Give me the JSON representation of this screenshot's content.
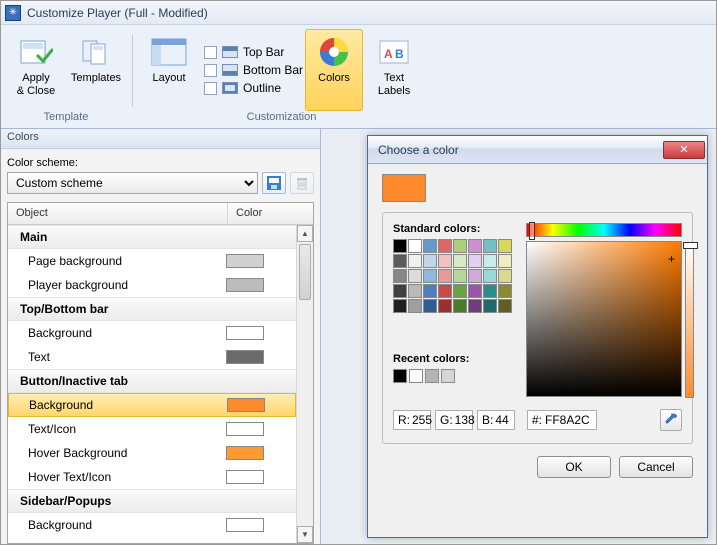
{
  "window": {
    "title": "Customize Player (Full - Modified)"
  },
  "ribbon": {
    "apply_close": "Apply\n& Close",
    "templates": "Templates",
    "layout": "Layout",
    "colors": "Colors",
    "text_labels": "Text\nLabels",
    "group_template": "Template",
    "group_customization": "Customization",
    "opt_topbar": "Top Bar",
    "opt_bottombar": "Bottom Bar",
    "opt_outline": "Outline"
  },
  "panel": {
    "title": "Colors",
    "scheme_label": "Color scheme:",
    "scheme_value": "Custom scheme",
    "col_object": "Object",
    "col_color": "Color",
    "rows": [
      {
        "type": "cat",
        "label": "Main"
      },
      {
        "type": "item",
        "label": "Page background",
        "color": "#d0d0d0"
      },
      {
        "type": "item",
        "label": "Player background",
        "color": "#bcbcbc"
      },
      {
        "type": "cat",
        "label": "Top/Bottom bar"
      },
      {
        "type": "item",
        "label": "Background",
        "color": "#ffffff"
      },
      {
        "type": "item",
        "label": "Text",
        "color": "#6b6b6b"
      },
      {
        "type": "cat",
        "label": "Button/Inactive tab"
      },
      {
        "type": "item",
        "label": "Background",
        "color": "#ff8a2c",
        "selected": true
      },
      {
        "type": "item",
        "label": "Text/Icon",
        "color": "#ffffff"
      },
      {
        "type": "item",
        "label": "Hover Background",
        "color": "#ff9a33"
      },
      {
        "type": "item",
        "label": "Hover Text/Icon",
        "color": "#ffffff"
      },
      {
        "type": "cat",
        "label": "Sidebar/Popups"
      },
      {
        "type": "item",
        "label": "Background",
        "color": "#ffffff"
      }
    ]
  },
  "dialog": {
    "title": "Choose a color",
    "current": "#ff8a2c",
    "standard_label": "Standard colors:",
    "recent_label": "Recent colors:",
    "standard": [
      "#000000",
      "#ffffff",
      "#6699cc",
      "#e06666",
      "#aad178",
      "#cc8fd1",
      "#70c1c1",
      "#d8d85a",
      "#5c5c5c",
      "#f0f0f0",
      "#c2d6eb",
      "#f2c2c2",
      "#d6ebc2",
      "#e6cff0",
      "#c8ebeb",
      "#efeec2",
      "#878787",
      "#dcdcdc",
      "#8fb8de",
      "#e69b9b",
      "#b3d998",
      "#d1aadb",
      "#9bd9d9",
      "#d9d98f",
      "#404040",
      "#bababa",
      "#4f80ba",
      "#c74a4a",
      "#6ea146",
      "#9b54a8",
      "#2f8c8c",
      "#8a8a2e",
      "#202020",
      "#9e9e9e",
      "#2f5d94",
      "#9e2f2f",
      "#4a7a2c",
      "#703b80",
      "#1f6a6a",
      "#5f5f1f"
    ],
    "recent": [
      "#000000",
      "#ffffff",
      "#b5b5b5",
      "#d6d6d6"
    ],
    "r_label": "R:",
    "g_label": "G:",
    "b_label": "B:",
    "hex_label": "#:",
    "r": "255",
    "g": "138",
    "b": "44",
    "hex": "FF8A2C",
    "ok": "OK",
    "cancel": "Cancel"
  }
}
